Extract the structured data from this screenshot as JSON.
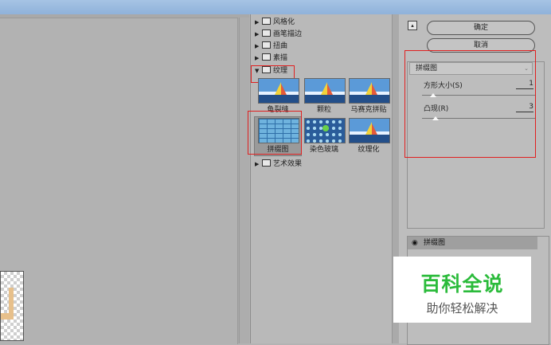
{
  "filter_gallery": {
    "categories": [
      {
        "label": "风格化",
        "expanded": false
      },
      {
        "label": "画笔描边",
        "expanded": false
      },
      {
        "label": "扭曲",
        "expanded": false
      },
      {
        "label": "素描",
        "expanded": false
      },
      {
        "label": "纹理",
        "expanded": true
      },
      {
        "label": "艺术效果",
        "expanded": false
      }
    ],
    "texture_filters": [
      "龟裂缝",
      "颗粒",
      "马赛克拼贴",
      "拼缀图",
      "染色玻璃",
      "纹理化"
    ],
    "selected_filter": "拼缀图"
  },
  "dialog": {
    "ok_label": "确定",
    "cancel_label": "取消",
    "collapse_glyph": "▴"
  },
  "params": {
    "filter_name": "拼缀图",
    "square_size_label": "方形大小(S)",
    "square_size_value": "1",
    "relief_label": "凸现(R)",
    "relief_value": "3"
  },
  "layers": {
    "items": [
      {
        "label": "拼缀图",
        "visible": true
      }
    ]
  },
  "watermark": {
    "title": "百科全说",
    "subtitle": "助你轻松解决"
  },
  "colors": {
    "highlight_red": "#e02020",
    "watermark_green": "#2bbb3b"
  }
}
